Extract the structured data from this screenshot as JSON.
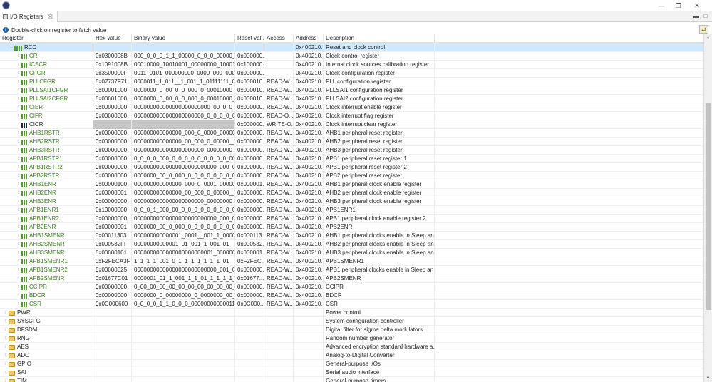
{
  "window": {
    "minimize_glyph": "—",
    "restore_glyph": "❐",
    "close_glyph": "✕"
  },
  "tab": {
    "label": "I/O Registers",
    "close_glyph": "☒"
  },
  "view_controls": {
    "minimize_glyph": "▬",
    "maximize_glyph": "□"
  },
  "info": {
    "message": "Double-click on register to fetch value"
  },
  "columns": [
    "Register",
    "Hex value",
    "Binary value",
    "Reset val...",
    "Access",
    "Address",
    "Description"
  ],
  "rows": [
    {
      "name": "RCC",
      "kind": "peripheral-open",
      "hex": "",
      "bin": "",
      "reset": "",
      "access": "",
      "addr": "0x400210...",
      "desc": "Reset and clock control",
      "selected": true
    },
    {
      "name": "CR",
      "kind": "reg",
      "hex": "0x0300008B",
      "bin": "000_0_0_0_1_1_00000_0_0_0_00000_0_0_...",
      "reset": "0x000000...",
      "access": "",
      "addr": "0x400210...",
      "desc": "Clock control register"
    },
    {
      "name": "ICSCR",
      "kind": "reg",
      "hex": "0x1091008B",
      "bin": "00010000_10010001_00000000_100010...",
      "reset": "0x100000...",
      "access": "",
      "addr": "0x400210...",
      "desc": "Internal clock sources calibration register"
    },
    {
      "name": "CFGR",
      "kind": "reg",
      "hex": "0x3500000F",
      "bin": "0011_0101_000000000_0000_000_0000_...",
      "reset": "0x000000...",
      "access": "",
      "addr": "0x400210...",
      "desc": "Clock configuration register"
    },
    {
      "name": "PLLCFGR",
      "kind": "reg",
      "hex": "0x07737F71",
      "bin": "0000011_1_011__1_001_1_01111111_01...",
      "reset": "0x000010...",
      "access": "READ-W...",
      "addr": "0x400210...",
      "desc": "PLL configuration register"
    },
    {
      "name": "PLLSAI1CFGR",
      "kind": "reg",
      "hex": "0x00001000",
      "bin": "0000000_0_00_0_0_000_0_00010000_000...",
      "reset": "0x000010...",
      "access": "READ-W...",
      "addr": "0x400210...",
      "desc": "PLLSAI1 configuration register"
    },
    {
      "name": "PLLSAI2CFGR",
      "kind": "reg",
      "hex": "0x00001000",
      "bin": "0000000_0_00_0_0_000_0_00010000_000...",
      "reset": "0x000010...",
      "access": "READ-W...",
      "addr": "0x400210...",
      "desc": "PLLSAI2 configuration register"
    },
    {
      "name": "CIER",
      "kind": "reg",
      "hex": "0x00000000",
      "bin": "000000000000000000000000_00_0_0_0_...",
      "reset": "0x000000...",
      "access": "READ-W...",
      "addr": "0x400210...",
      "desc": "Clock interrupt enable register"
    },
    {
      "name": "CIFR",
      "kind": "reg",
      "hex": "0x00000000",
      "bin": "0000000000000000000000_0_0_0_0_0_...",
      "reset": "0x000000...",
      "access": "READ-O...",
      "addr": "0x400210...",
      "desc": "Clock interrupt flag register"
    },
    {
      "name": "CICR",
      "kind": "reg-black",
      "hex": "",
      "bin": "",
      "grey": true,
      "reset": "0x000000...",
      "access": "WRITE-O...",
      "addr": "0x400210...",
      "desc": "Clock interrupt clear register"
    },
    {
      "name": "AHB1RSTR",
      "kind": "reg",
      "hex": "0x00000000",
      "bin": "000000000000000_000_0_0000_00000_...",
      "reset": "0x000000...",
      "access": "READ-W...",
      "addr": "0x400210...",
      "desc": "AHB1 peripheral reset register"
    },
    {
      "name": "AHB2RSTR",
      "kind": "reg",
      "hex": "0x00000000",
      "bin": "000000000000000_00_000_0_00000__0_...",
      "reset": "0x000000...",
      "access": "READ-W...",
      "addr": "0x400210...",
      "desc": "AHB2 peripheral reset register"
    },
    {
      "name": "AHB3RSTR",
      "kind": "reg",
      "hex": "0x00000000",
      "bin": "0000000000000000000000_00000000",
      "reset": "0x000000...",
      "access": "READ-W...",
      "addr": "0x400210...",
      "desc": "AHB3 peripheral reset register"
    },
    {
      "name": "APB1RSTR1",
      "kind": "reg",
      "hex": "0x00000000",
      "bin": "0_0_0_0_000_0_0_0_0_0_0_0_0_0_00_0_0_0...",
      "reset": "0x000000...",
      "access": "READ-W...",
      "addr": "0x400210...",
      "desc": "APB1 peripheral reset register 1"
    },
    {
      "name": "APB1RSTR2",
      "kind": "reg",
      "hex": "0x00000000",
      "bin": "00000000000000000000000000_000_00",
      "reset": "0x000000...",
      "access": "READ-W...",
      "addr": "0x400210...",
      "desc": "APB1 peripheral reset register 2"
    },
    {
      "name": "APB2RSTR",
      "kind": "reg",
      "hex": "0x00000000",
      "bin": "0000000_00_0_000_0_0_0_0_0_0_0_0_0_0_...",
      "reset": "0x000000...",
      "access": "READ-W...",
      "addr": "0x400210...",
      "desc": "APB2 peripheral reset register"
    },
    {
      "name": "AHB1ENR",
      "kind": "reg",
      "hex": "0x00000100",
      "bin": "000000000000000_000_0_0001_00000_...",
      "reset": "0x000001...",
      "access": "READ-W...",
      "addr": "0x400210...",
      "desc": "AHB1 peripheral clock enable register"
    },
    {
      "name": "AHB2ENR",
      "kind": "reg",
      "hex": "0x00000001",
      "bin": "000000000000000_00_000_0_00000__0_...",
      "reset": "0x000000...",
      "access": "READ-W...",
      "addr": "0x400210...",
      "desc": "AHB2 peripheral clock enable register"
    },
    {
      "name": "AHB3ENR",
      "kind": "reg",
      "hex": "0x00000000",
      "bin": "0000000000000000000000_00000000",
      "reset": "0x000000...",
      "access": "READ-W...",
      "addr": "0x400210...",
      "desc": "AHB3 peripheral clock enable register"
    },
    {
      "name": "APB1ENR1",
      "kind": "reg",
      "hex": "0x10000000",
      "bin": "0_0_0_1_000_00_0_0_0_0_0_0_0_0_00_0_0_...",
      "reset": "0x000000...",
      "access": "READ-W...",
      "addr": "0x400210...",
      "desc": "APB1ENR1"
    },
    {
      "name": "APB1ENR2",
      "kind": "reg",
      "hex": "0x00000000",
      "bin": "00000000000000000000000000_000_00",
      "reset": "0x000000...",
      "access": "READ-W...",
      "addr": "0x400210...",
      "desc": "APB1 peripheral clock enable register 2"
    },
    {
      "name": "APB2ENR",
      "kind": "reg",
      "hex": "0x00000001",
      "bin": "0000000_00_0_000_0_0_0_0_0_0_0_0_0_0_...",
      "reset": "0x000000...",
      "access": "READ-W...",
      "addr": "0x400210...",
      "desc": "APB2ENR"
    },
    {
      "name": "AHB1SMENR",
      "kind": "reg",
      "hex": "0x00011303",
      "bin": "000000000000001_0001__001_1_00000...",
      "reset": "0x000113...",
      "access": "READ-W...",
      "addr": "0x400210...",
      "desc": "AHB1 peripheral clocks enable in Sleep an..."
    },
    {
      "name": "AHB2SMENR",
      "kind": "reg",
      "hex": "0x000532FF",
      "bin": "00000000000001_01_001_1_001_01__1_...",
      "reset": "0x000532...",
      "access": "READ-W...",
      "addr": "0x400210...",
      "desc": "AHB2 peripheral clocks enable in Sleep an..."
    },
    {
      "name": "AHB3SMENR",
      "kind": "reg",
      "hex": "0x00000101",
      "bin": "0000000000000000000000001_00000001",
      "reset": "0x000001...",
      "access": "READ-W...",
      "addr": "0x400210...",
      "desc": "AHB3 peripheral clocks enable in Sleep an..."
    },
    {
      "name": "APB1SMENR1",
      "kind": "reg",
      "hex": "0xF2FECA3F",
      "bin": "1_1_1_1_001_0_1_1_1_1_1_1_1_01__1_001...",
      "reset": "0xF2FEC...",
      "access": "READ-W...",
      "addr": "0x400210...",
      "desc": "APB1SMENR1"
    },
    {
      "name": "APB1SMENR2",
      "kind": "reg",
      "hex": "0x00000025",
      "bin": "00000000000000000000000000_001_01",
      "reset": "0x000000...",
      "access": "READ-W...",
      "addr": "0x400210...",
      "desc": "APB1 peripheral clocks enable in Sleep an..."
    },
    {
      "name": "APB2SMENR",
      "kind": "reg",
      "hex": "0x01677C01",
      "bin": "0000001_01_1_001_1_1_01_1_1_1_1_00...",
      "reset": "0x01677...",
      "access": "READ-W...",
      "addr": "0x400210...",
      "desc": "APB2SMENR"
    },
    {
      "name": "CCIPR",
      "kind": "reg",
      "hex": "0x00000000",
      "bin": "0_00_00_00_00_00_00_00_00_00_00_0...",
      "reset": "0x000000...",
      "access": "READ-W...",
      "addr": "0x400210...",
      "desc": "CCIPR"
    },
    {
      "name": "BDCR",
      "kind": "reg",
      "hex": "0x00000000",
      "bin": "0000000_0_00000000_0_0000000_00_0_0_0...",
      "reset": "0x000000...",
      "access": "READ-W...",
      "addr": "0x400210...",
      "desc": "BDCR"
    },
    {
      "name": "CSR",
      "kind": "reg",
      "hex": "0x0C000600",
      "bin": "0_0_0_0_1_1_0_0_0_000000000000110_0...",
      "reset": "0x0C000...",
      "access": "READ-W...",
      "addr": "0x400210...",
      "desc": "CSR"
    },
    {
      "name": "PWR",
      "kind": "peripheral",
      "hex": "",
      "bin": "",
      "reset": "",
      "access": "",
      "addr": "",
      "desc": "Power control"
    },
    {
      "name": "SYSCFG",
      "kind": "peripheral",
      "hex": "",
      "bin": "",
      "reset": "",
      "access": "",
      "addr": "",
      "desc": "System configuration controller"
    },
    {
      "name": "DFSDM",
      "kind": "peripheral",
      "hex": "",
      "bin": "",
      "reset": "",
      "access": "",
      "addr": "",
      "desc": "Digital filter for sigma delta modulators"
    },
    {
      "name": "RNG",
      "kind": "peripheral",
      "hex": "",
      "bin": "",
      "reset": "",
      "access": "",
      "addr": "",
      "desc": "Random number generator"
    },
    {
      "name": "AES",
      "kind": "peripheral",
      "hex": "",
      "bin": "",
      "reset": "",
      "access": "",
      "addr": "",
      "desc": "Advanced encryption standard hardware a..."
    },
    {
      "name": "ADC",
      "kind": "peripheral",
      "hex": "",
      "bin": "",
      "reset": "",
      "access": "",
      "addr": "",
      "desc": "Analog-to-Digital Converter"
    },
    {
      "name": "GPIO",
      "kind": "peripheral",
      "hex": "",
      "bin": "",
      "reset": "",
      "access": "",
      "addr": "",
      "desc": "General-purpose I/Os"
    },
    {
      "name": "SAI",
      "kind": "peripheral",
      "hex": "",
      "bin": "",
      "reset": "",
      "access": "",
      "addr": "",
      "desc": "Serial audio interface"
    },
    {
      "name": "TIM",
      "kind": "peripheral",
      "hex": "",
      "bin": "",
      "reset": "",
      "access": "",
      "addr": "",
      "desc": "General-purpose-timers"
    }
  ],
  "colors": {
    "selection": "#cde8ff",
    "register_name": "#3a7d1f",
    "scroll_thumb": "#c2c2c2"
  }
}
